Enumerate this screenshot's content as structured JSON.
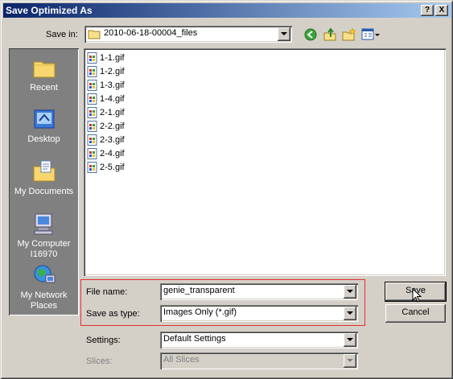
{
  "window": {
    "title": "Save Optimized As"
  },
  "titlebar_buttons": {
    "help": "?",
    "close": "X"
  },
  "save_in": {
    "label": "Save in:",
    "value": "2010-06-18-00004_files"
  },
  "places": [
    {
      "label": "Recent"
    },
    {
      "label": "Desktop"
    },
    {
      "label": "My Documents"
    },
    {
      "label": "My Computer\nI16970"
    },
    {
      "label": "My Network\nPlaces"
    }
  ],
  "files": [
    "1-1.gif",
    "1-2.gif",
    "1-3.gif",
    "1-4.gif",
    "2-1.gif",
    "2-2.gif",
    "2-3.gif",
    "2-4.gif",
    "2-5.gif"
  ],
  "form": {
    "file_name_label": "File name:",
    "file_name_value": "genie_transparent",
    "save_type_label": "Save as type:",
    "save_type_value": "Images Only (*.gif)",
    "settings_label": "Settings:",
    "settings_value": "Default Settings",
    "slices_label": "Slices:",
    "slices_value": "All Slices"
  },
  "buttons": {
    "save": "Save",
    "cancel": "Cancel"
  },
  "colors": {
    "title_start": "#0a246a",
    "title_end": "#a6caf0",
    "highlight": "#e03030"
  }
}
